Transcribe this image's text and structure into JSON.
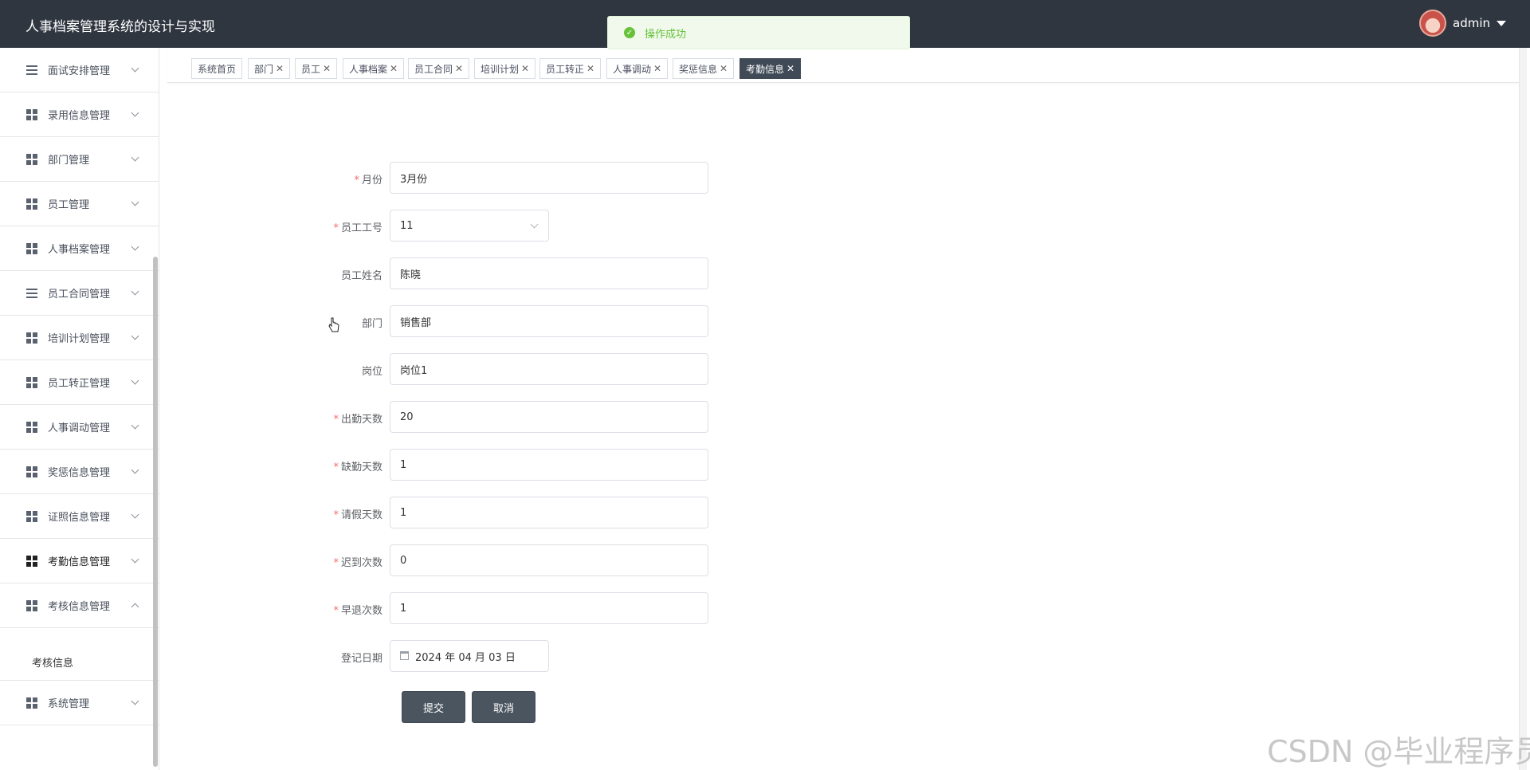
{
  "header": {
    "title": "人事档案管理系统的设计与实现",
    "username": "admin"
  },
  "toast": {
    "message": "操作成功"
  },
  "sidebar": {
    "items": [
      {
        "label": "面试安排管理",
        "icon": "list-icon"
      },
      {
        "label": "录用信息管理",
        "icon": "grid-icon"
      },
      {
        "label": "部门管理",
        "icon": "building-icon"
      },
      {
        "label": "员工管理",
        "icon": "apps-icon"
      },
      {
        "label": "人事档案管理",
        "icon": "briefcase-icon"
      },
      {
        "label": "员工合同管理",
        "icon": "sliders-icon"
      },
      {
        "label": "培训计划管理",
        "icon": "grid-icon"
      },
      {
        "label": "员工转正管理",
        "icon": "chat-icon"
      },
      {
        "label": "人事调动管理",
        "icon": "ticket-icon"
      },
      {
        "label": "奖惩信息管理",
        "icon": "clipboard-icon"
      },
      {
        "label": "证照信息管理",
        "icon": "grid-icon"
      },
      {
        "label": "考勤信息管理",
        "icon": "grid-icon"
      },
      {
        "label": "考核信息管理",
        "icon": "grid-icon"
      },
      {
        "label": "系统管理",
        "icon": "grid-icon"
      }
    ],
    "submenu": {
      "label": "考核信息"
    }
  },
  "tabs": [
    {
      "label": "系统首页"
    },
    {
      "label": "部门"
    },
    {
      "label": "员工"
    },
    {
      "label": "人事档案"
    },
    {
      "label": "员工合同"
    },
    {
      "label": "培训计划"
    },
    {
      "label": "员工转正"
    },
    {
      "label": "人事调动"
    },
    {
      "label": "奖惩信息"
    },
    {
      "label": "考勤信息"
    }
  ],
  "form": {
    "month": {
      "label": "月份",
      "value": "3月份"
    },
    "employee_no": {
      "label": "员工工号",
      "value": "11"
    },
    "employee_name": {
      "label": "员工姓名",
      "value": "陈晓"
    },
    "department": {
      "label": "部门",
      "value": "销售部"
    },
    "position": {
      "label": "岗位",
      "value": "岗位1"
    },
    "attendance_days": {
      "label": "出勤天数",
      "value": "20"
    },
    "absent_days": {
      "label": "缺勤天数",
      "value": "1"
    },
    "leave_days": {
      "label": "请假天数",
      "value": "1"
    },
    "late_count": {
      "label": "迟到次数",
      "value": "0"
    },
    "early_leave_count": {
      "label": "早退次数",
      "value": "1"
    },
    "register_date": {
      "label": "登记日期",
      "value": "2024 年 04 月 03 日"
    },
    "submit_label": "提交",
    "cancel_label": "取消"
  },
  "watermark": "CSDN @毕业程序员",
  "colors": {
    "header_bg": "#2f3640",
    "active_tab": "#3f4a56",
    "success": "#67c23a",
    "required": "#f56c6c",
    "button": "#4a5560"
  }
}
